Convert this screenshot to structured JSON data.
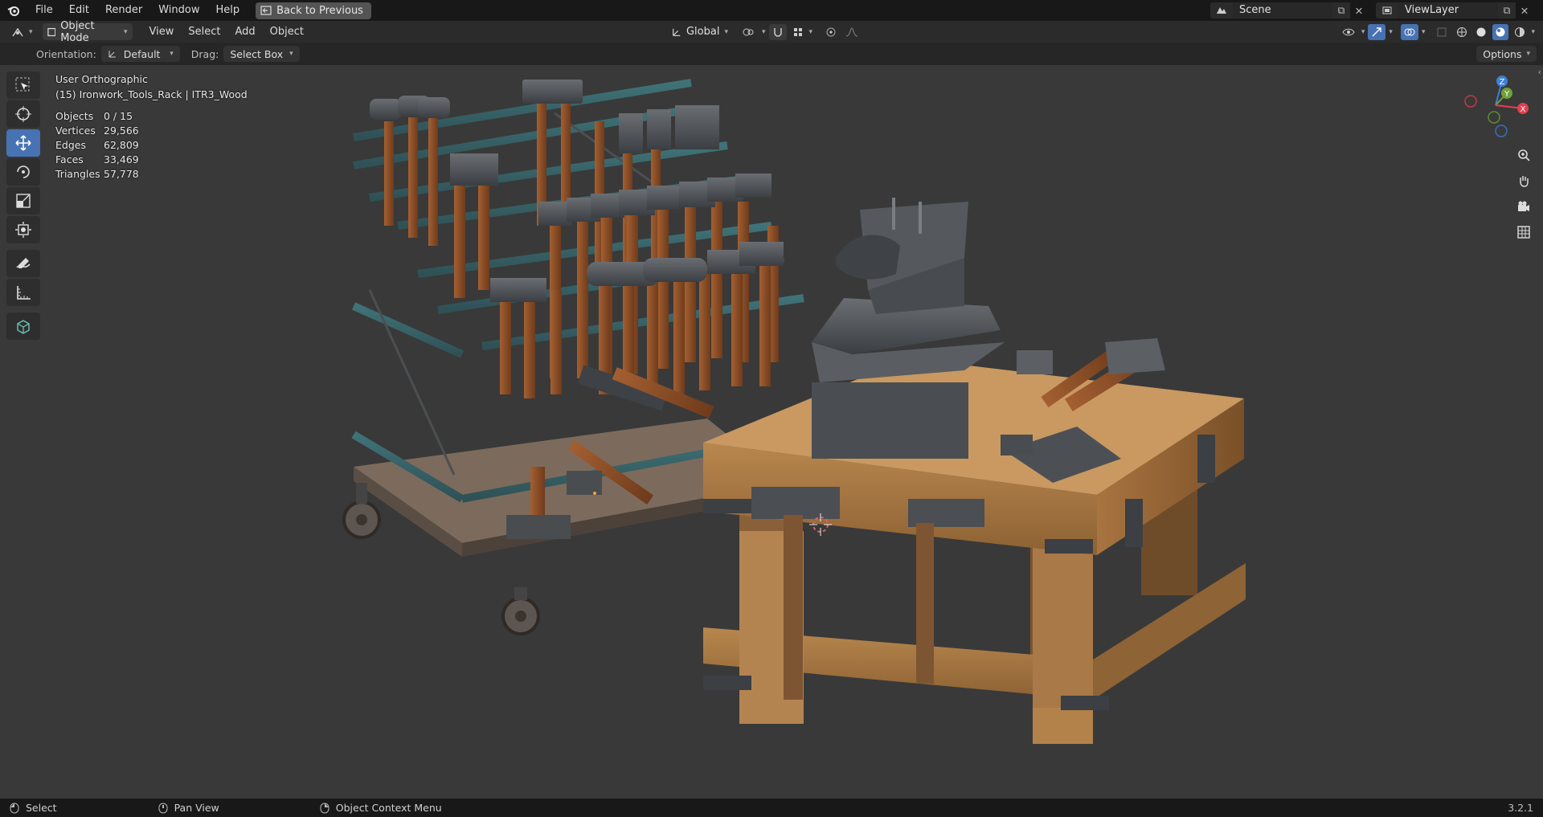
{
  "menu": {
    "items": [
      "File",
      "Edit",
      "Render",
      "Window",
      "Help"
    ],
    "back_label": "Back to Previous",
    "scene_label": "Scene",
    "viewlayer_label": "ViewLayer"
  },
  "header": {
    "mode_label": "Object Mode",
    "view": "View",
    "select": "Select",
    "add": "Add",
    "object": "Object",
    "transform_orientation": "Global"
  },
  "toolrow": {
    "orientation_label": "Orientation:",
    "orientation_value": "Default",
    "drag_label": "Drag:",
    "drag_value": "Select Box",
    "options_label": "Options"
  },
  "overlay": {
    "view_name": "User Orthographic",
    "object_name": "(15) Ironwork_Tools_Rack | ITR3_Wood",
    "stats": [
      {
        "key": "Objects",
        "value": "0 / 15"
      },
      {
        "key": "Vertices",
        "value": "29,566"
      },
      {
        "key": "Edges",
        "value": "62,809"
      },
      {
        "key": "Faces",
        "value": "33,469"
      },
      {
        "key": "Triangles",
        "value": "57,778"
      }
    ]
  },
  "gizmo": {
    "x_color": "#e0404f",
    "y_color": "#6fa13a",
    "z_color": "#3d7fd6"
  },
  "statusbar": {
    "select": "Select",
    "pan": "Pan View",
    "context": "Object Context Menu",
    "version": "3.2.1"
  },
  "tools": [
    "select-box-icon",
    "cursor-icon",
    "move-icon",
    "rotate-icon",
    "scale-icon",
    "transform-icon",
    "annotate-icon",
    "measure-icon",
    "add-cube-icon"
  ]
}
